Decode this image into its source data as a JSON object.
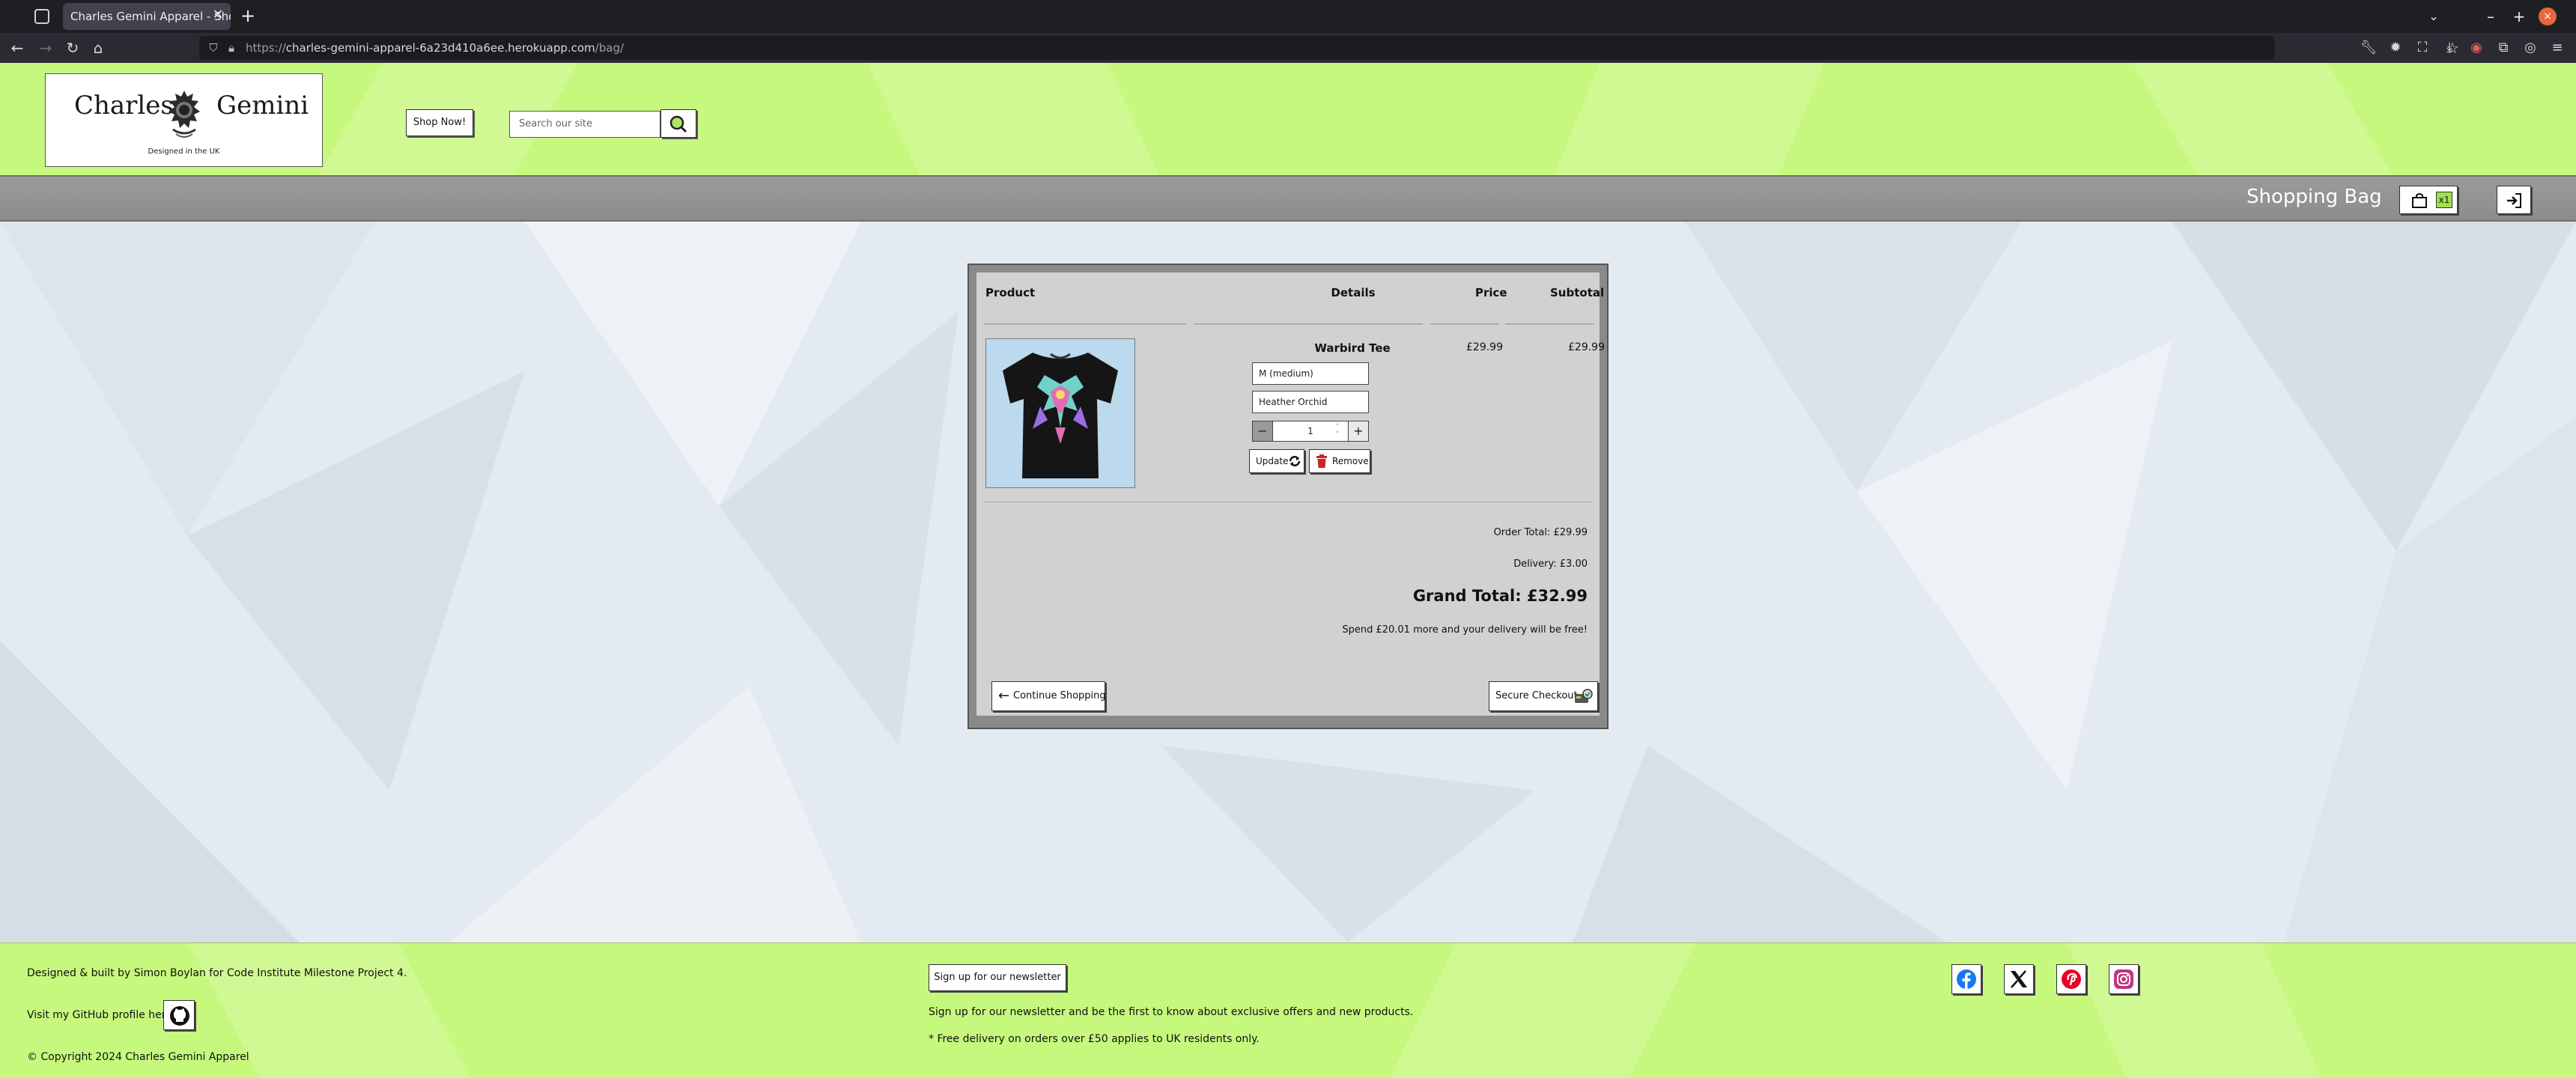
{
  "browser": {
    "tab_title": "Charles Gemini Apparel - Shopping Bag",
    "url_prefix": "https://",
    "url_host": "charles-gemini-apparel-6a23d410a6ee.herokuapp.com",
    "url_path": "/bag/"
  },
  "header": {
    "logo_word_left": "Charles",
    "logo_word_right": "Gemini",
    "logo_tagline": "Designed in the UK",
    "shop_now": "Shop Now!",
    "search_placeholder": "Search our site"
  },
  "subbar": {
    "title": "Shopping Bag",
    "bag_count": "x1"
  },
  "bag": {
    "columns": {
      "product": "Product",
      "details": "Details",
      "price": "Price",
      "subtotal": "Subtotal"
    },
    "item": {
      "name": "Warbird Tee",
      "size": "M (medium)",
      "colour": "Heather Orchid",
      "quantity": "1",
      "price": "£29.99",
      "subtotal": "£29.99",
      "update_label": "Update",
      "remove_label": "Remove"
    },
    "order_total": "Order Total: £29.99",
    "delivery": "Delivery: £3.00",
    "grand_total": "Grand Total: £32.99",
    "free_delivery_note": "Spend £20.01 more and your delivery will be free!",
    "continue_label": "Continue Shopping",
    "checkout_label": "Secure Checkout"
  },
  "footer": {
    "credit": "Designed & built by Simon Boylan for Code Institute Milestone Project 4.",
    "github_label": "Visit my GitHub profile here:",
    "copyright": "© Copyright 2024 Charles Gemini Apparel",
    "newsletter_button": "Sign up for our newsletter",
    "newsletter_text": "Sign up for our newsletter and be the first to know about exclusive offers and new products.",
    "delivery_note": "* Free delivery on orders over £50 applies to UK residents only.",
    "socials": [
      "facebook",
      "x",
      "pinterest",
      "instagram"
    ]
  },
  "colors": {
    "header_green": "#c6f87d",
    "subbar_grey": "#8c8c8c",
    "card_grey": "#d1d1d1",
    "facebook": "#1877f2",
    "pinterest": "#e60023",
    "instagram": "#c13584",
    "firefox_accent": "#e7683d"
  }
}
